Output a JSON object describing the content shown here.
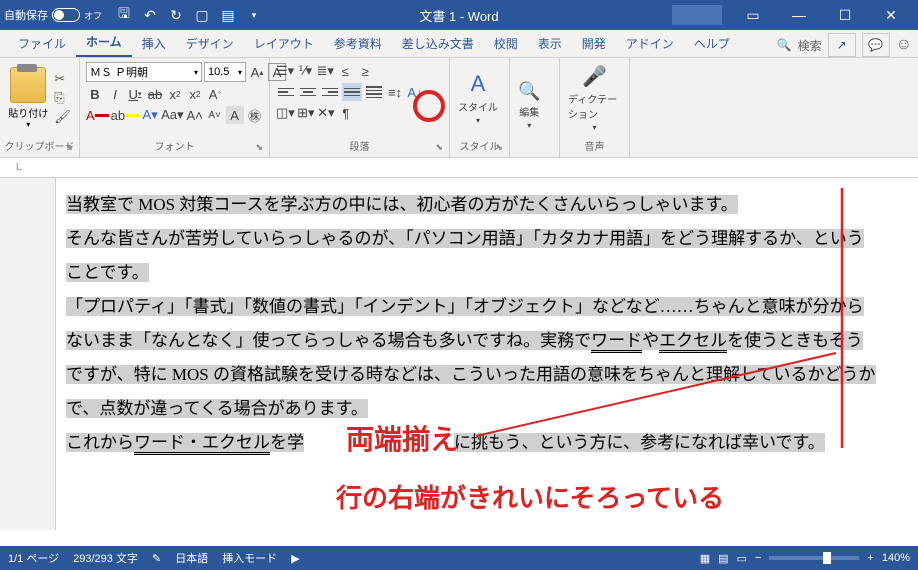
{
  "titlebar": {
    "autosave_label": "自動保存",
    "autosave_state": "オフ",
    "doc_title": "文書 1 - Word"
  },
  "tabs": {
    "items": [
      "ファイル",
      "ホーム",
      "挿入",
      "デザイン",
      "レイアウト",
      "参考資料",
      "差し込み文書",
      "校閲",
      "表示",
      "開発",
      "アドイン",
      "ヘルプ"
    ],
    "active": 1,
    "search": "検索"
  },
  "ribbon": {
    "clipboard": {
      "label": "クリップボード",
      "paste": "貼り付け"
    },
    "font": {
      "label": "フォント",
      "name": "ＭＳ Ｐ明朝",
      "size": "10.5"
    },
    "paragraph": {
      "label": "段落"
    },
    "style": {
      "label": "スタイル",
      "btn": "スタイル"
    },
    "edit": {
      "label": "",
      "btn": "編集"
    },
    "voice": {
      "label": "音声",
      "btn": "ディクテーション"
    }
  },
  "document": {
    "p1": "当教室で MOS 対策コースを学ぶ方の中には、初心者の方がたくさんいらっしゃいます。",
    "p2": "そんな皆さんが苦労していらっしゃるのが、「パソコン用語」「カタカナ用語」をどう理解するか、ということです。",
    "p3a": "「プロパティ」「書式」「数値の書式」「インデント」「オブジェクト」などなど……ちゃんと意味が分からないまま「なんとなく」使ってらっしゃる場合も多いですね。実務で",
    "p3b": "ワード",
    "p3c": "や",
    "p3d": "エクセル",
    "p3e": "を使うときもそうですが、特に MOS の資格試験を受ける時などは、こういった用語の意味をちゃんと理解しているかどうかで、点数が違ってくる場合があります。",
    "p4a": "これから",
    "p4b": "ワード・エクセル",
    "p4c": "を学",
    "p4d": "に挑もう、という方に、参考になれば幸いです。"
  },
  "annotations": {
    "a1": "両端揃え",
    "a2": "行の右端がきれいにそろっている"
  },
  "status": {
    "page": "1/1 ページ",
    "words": "293/293 文字",
    "lang": "日本語",
    "mode": "挿入モード",
    "zoom": "140%"
  }
}
